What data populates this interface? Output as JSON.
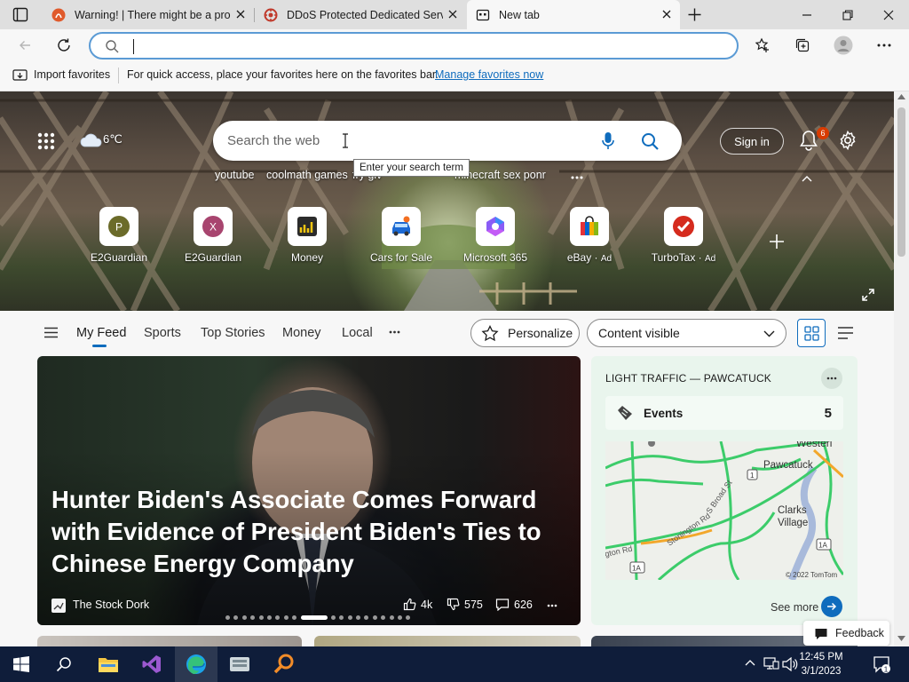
{
  "tabs": [
    {
      "title": "Warning! | There might be a problem",
      "favicon": "warning-favicon"
    },
    {
      "title": "DDoS Protected Dedicated Servers",
      "favicon": "ddos-favicon"
    },
    {
      "title": "New tab",
      "favicon": "newtab-favicon",
      "active": true
    }
  ],
  "address": {
    "value": "",
    "placeholder": ""
  },
  "favorites_bar": {
    "import_label": "Import favorites",
    "message": "For quick access, place your favorites here on the favorites bar.",
    "manage_link": "Manage favorites now"
  },
  "hero": {
    "weather": "6℃",
    "search_placeholder": "Search the web",
    "tooltip": "Enter your search term",
    "trending": [
      "youtube",
      "coolmath games",
      "fry giv",
      "minecraft sex ponr"
    ],
    "sign_in": "Sign in",
    "notification_count": "6",
    "tiles": [
      {
        "label": "E2Guardian",
        "letter": "P",
        "ad": ""
      },
      {
        "label": "E2Guardian",
        "letter": "X",
        "ad": ""
      },
      {
        "label": "Money",
        "letter": "",
        "ad": ""
      },
      {
        "label": "Cars for Sale",
        "letter": "",
        "ad": ""
      },
      {
        "label": "Microsoft 365",
        "letter": "",
        "ad": ""
      },
      {
        "label": "eBay",
        "letter": "",
        "ad": "Ad"
      },
      {
        "label": "TurboTax",
        "letter": "",
        "ad": "Ad"
      }
    ]
  },
  "feed_nav": {
    "items": [
      "My Feed",
      "Sports",
      "Top Stories",
      "Money",
      "Local"
    ],
    "personalize": "Personalize",
    "content_visible": "Content visible"
  },
  "main_card": {
    "headline": "Hunter Biden's Associate Comes Forward with Evidence of President Biden's Ties to Chinese Energy Company",
    "source": "The Stock Dork",
    "likes": "4k",
    "dislikes": "575",
    "comments": "626",
    "slide_count": 20,
    "active_slide": 9
  },
  "traffic_card": {
    "title": "LIGHT TRAFFIC — PAWCATUCK",
    "events_label": "Events",
    "events_count": "5",
    "map_labels": [
      "Westerl",
      "Pawcatuck",
      "Clarks",
      "Village",
      "Stonington Rd",
      "S Broad St",
      "gton Rd",
      "1A",
      "1A",
      "1",
      "© 2022 TomTom"
    ],
    "see_more": "See more"
  },
  "feedback": "Feedback",
  "taskbar": {
    "time": "12:45 PM",
    "date": "3/1/2023",
    "notifications": "1"
  }
}
